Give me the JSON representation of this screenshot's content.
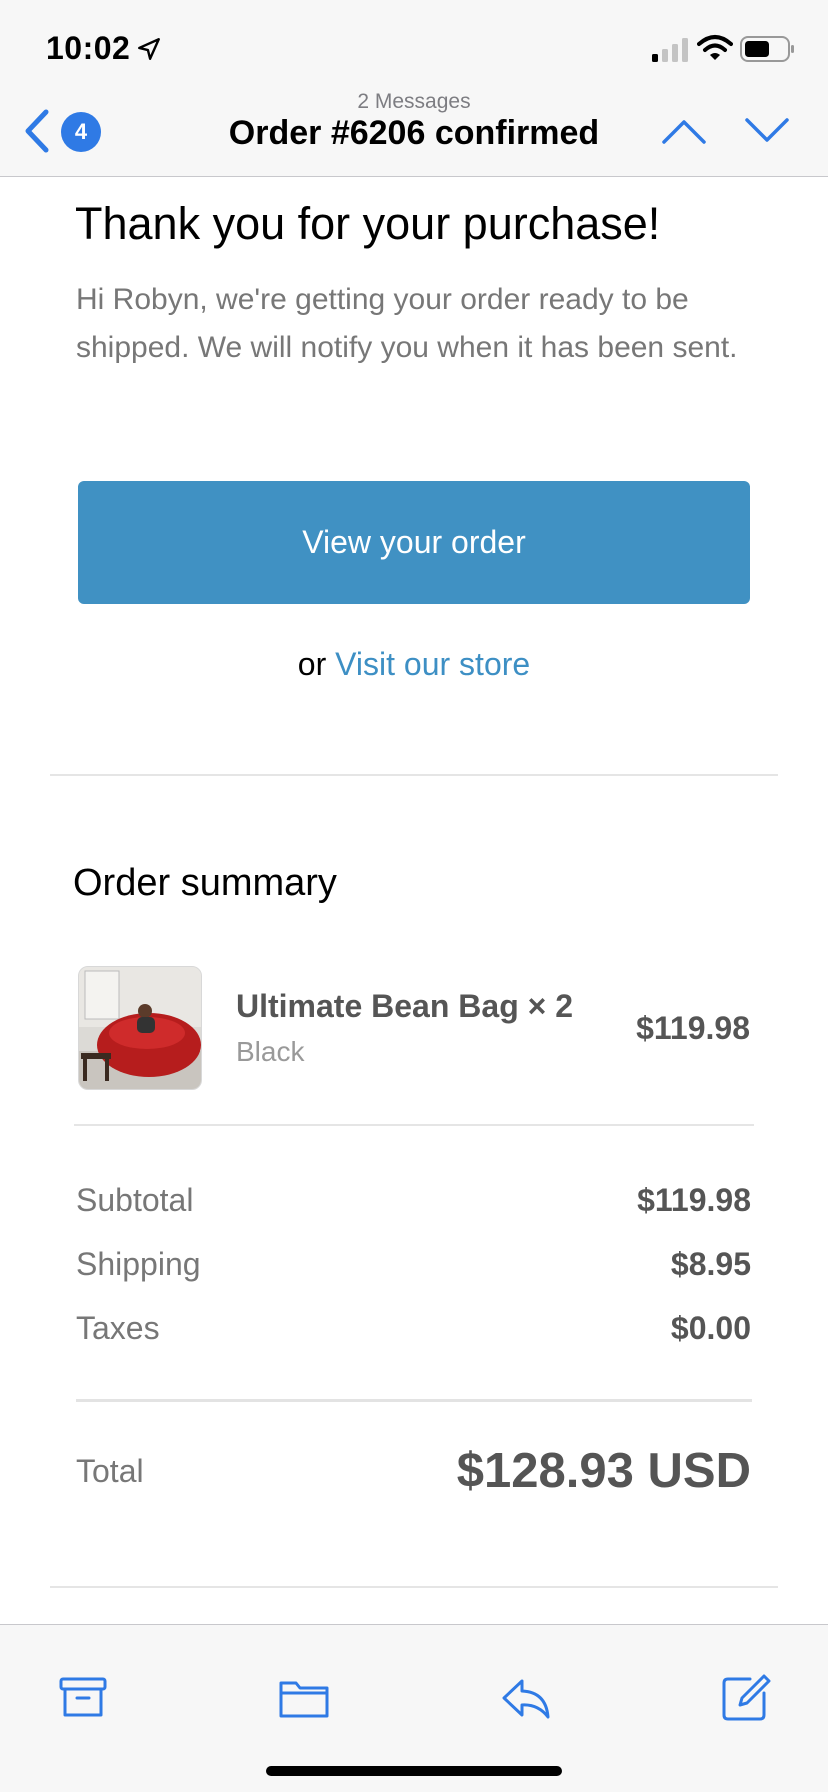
{
  "status_bar": {
    "time": "10:02"
  },
  "nav": {
    "back_count": "4",
    "message_count": "2 Messages",
    "title": "Order #6206 confirmed"
  },
  "email": {
    "headline": "Thank you for your purchase!",
    "intro": "Hi Robyn, we're getting your order ready to be shipped. We will notify you when it has been sent.",
    "cta_label": "View your order",
    "or_text": "or",
    "store_link": "Visit our store"
  },
  "order_summary": {
    "title": "Order summary",
    "items": [
      {
        "name": "Ultimate Bean Bag × 2",
        "variant": "Black",
        "price": "$119.98"
      }
    ],
    "subtotal_label": "Subtotal",
    "subtotal_value": "$119.98",
    "shipping_label": "Shipping",
    "shipping_value": "$8.95",
    "taxes_label": "Taxes",
    "taxes_value": "$0.00",
    "total_label": "Total",
    "total_value": "$128.93 USD"
  },
  "toolbar": {
    "items": [
      {
        "icon": "archive-icon"
      },
      {
        "icon": "folder-icon"
      },
      {
        "icon": "reply-icon"
      },
      {
        "icon": "compose-icon"
      }
    ]
  },
  "colors": {
    "accent_ios": "#2f7ae5",
    "button_blue": "#4091c3",
    "link_blue": "#3d8fc4"
  }
}
